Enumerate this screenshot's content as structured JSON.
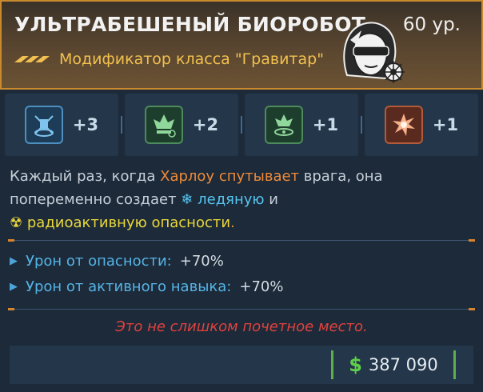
{
  "header": {
    "title": "УЛЬТРАБЕШЕНЫЙ БИОРОБОТ",
    "level": "60 ур.",
    "modifier": "Модификатор класса \"Гравитар\""
  },
  "skills": [
    {
      "bonus": "+3",
      "icon": "drone-skill-icon",
      "color": "#4f8fbf"
    },
    {
      "bonus": "+2",
      "icon": "bio-growth-icon",
      "color": "#4d8a5c"
    },
    {
      "bonus": "+1",
      "icon": "bio-hazard-icon",
      "color": "#4d8a5c"
    },
    {
      "bonus": "+1",
      "icon": "explosion-icon",
      "color": "#b35a3a"
    }
  ],
  "description": {
    "part1": "Каждый раз, когда ",
    "harlowe": "Харлоу",
    "part2": " ",
    "entangles": "спутывает",
    "part3": " врага, она попеременно создает ",
    "icy": "ледяную",
    "part4": " и ",
    "radio": "радиоактивную опасности",
    "part5": "."
  },
  "stats": [
    {
      "label": "Урон от опасности:",
      "value": "+70%"
    },
    {
      "label": "Урон от активного навыка:",
      "value": "+70%"
    }
  ],
  "flavor": "Это не слишком почетное место.",
  "price": {
    "currency": "$",
    "amount": "387 090"
  },
  "colors": {
    "accent": "#c98a2e",
    "hazard": "#ef8a37",
    "cash": "#5fd04a",
    "flavor": "#e0413d"
  }
}
